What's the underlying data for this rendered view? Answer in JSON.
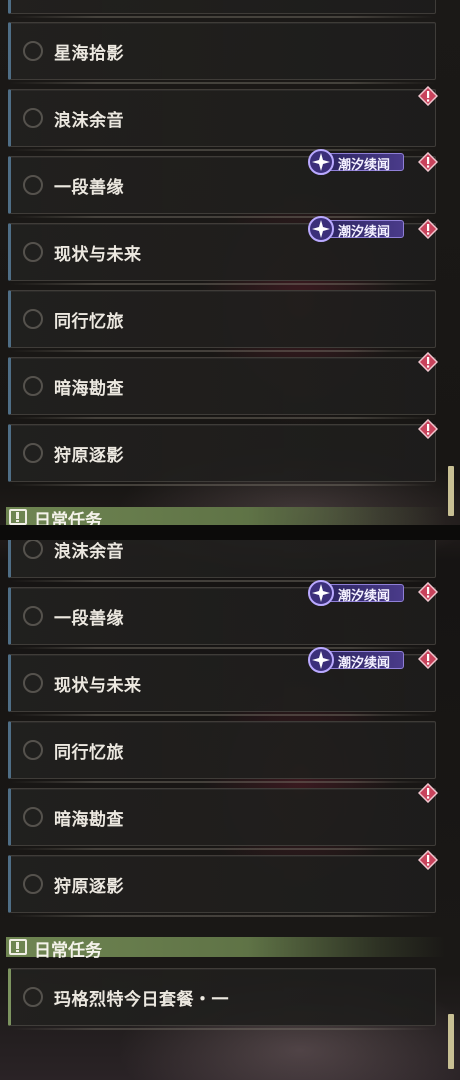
{
  "quests_top": [
    "星海拾影",
    "浪沫余音",
    "一段善缘",
    "现状与未来",
    "同行忆旅",
    "暗海勘查",
    "狩原逐影"
  ],
  "quests_bottom": [
    "浪沫余音",
    "一段善缘",
    "现状与未来",
    "同行忆旅",
    "暗海勘查",
    "狩原逐影"
  ],
  "badge_label": "潮汐续闻",
  "section": {
    "title": "日常任务"
  },
  "daily": [
    "玛格烈特今日套餐・一"
  ],
  "colors": {
    "quest_accent": "#4f6e86",
    "daily_accent": "#7d9460",
    "alert": "#c8435c",
    "badge": "#4a3b8a",
    "section_bar": "#6f8552",
    "scrollbar": "#c8c094"
  },
  "icons": {
    "radio": "radio-circle-icon",
    "alert": "exclamation-diamond-icon",
    "badge": "sparkle-tide-icon",
    "section": "exclamation-box-icon"
  }
}
